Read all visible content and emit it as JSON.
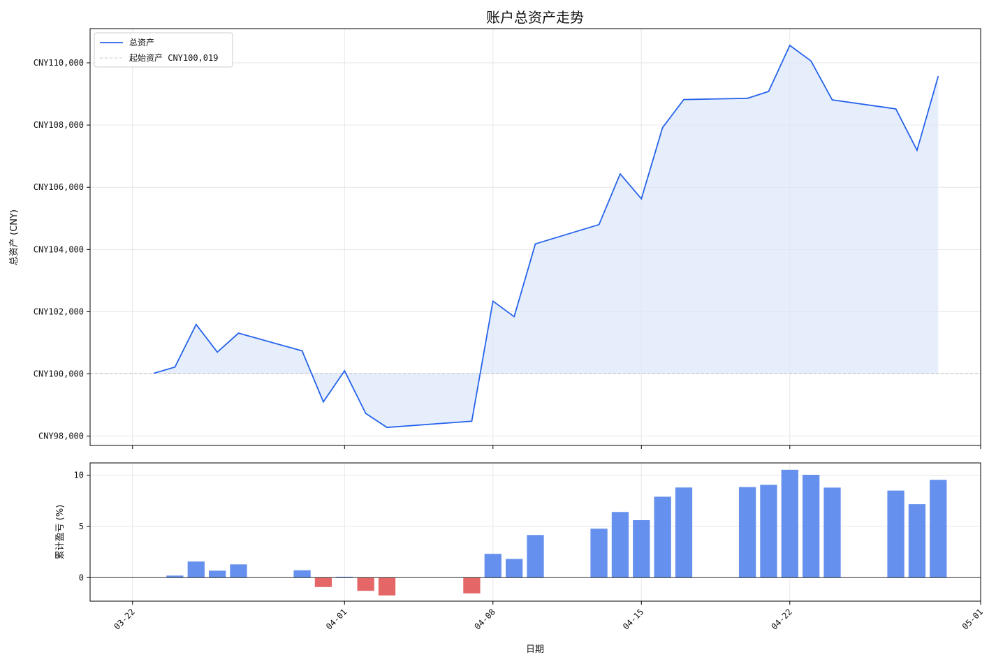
{
  "chart_data": [
    {
      "type": "line",
      "title": "账户总资产走势",
      "xlabel": "",
      "ylabel": "总资产 (CNY)",
      "x_axis_type": "date",
      "xlim": [
        "2024-03-20",
        "2024-05-01"
      ],
      "ylim": [
        97700,
        111100
      ],
      "yticks": [
        98000,
        100000,
        102000,
        104000,
        106000,
        108000,
        110000
      ],
      "ytick_labels": [
        "CNY98,000",
        "CNY100,000",
        "CNY102,000",
        "CNY104,000",
        "CNY106,000",
        "CNY108,000",
        "CNY110,000"
      ],
      "xticks": [
        "2024-03-22",
        "2024-04-01",
        "2024-04-08",
        "2024-04-15",
        "2024-04-22",
        "2024-05-01"
      ],
      "grid": true,
      "legend": "upper-left",
      "series": [
        {
          "name": "总资产",
          "color": "#2563eb",
          "fill": "#dbe6f9",
          "points": [
            [
              "2024-03-23",
              100019
            ],
            [
              "2024-03-24",
              100220
            ],
            [
              "2024-03-25",
              101590
            ],
            [
              "2024-03-26",
              100700
            ],
            [
              "2024-03-27",
              101310
            ],
            [
              "2024-03-30",
              100740
            ],
            [
              "2024-03-31",
              99100
            ],
            [
              "2024-04-01",
              100100
            ],
            [
              "2024-04-02",
              98730
            ],
            [
              "2024-04-03",
              98280
            ],
            [
              "2024-04-07",
              98480
            ],
            [
              "2024-04-08",
              102340
            ],
            [
              "2024-04-09",
              101840
            ],
            [
              "2024-04-10",
              104180
            ],
            [
              "2024-04-13",
              104800
            ],
            [
              "2024-04-14",
              106430
            ],
            [
              "2024-04-15",
              105630
            ],
            [
              "2024-04-16",
              107920
            ],
            [
              "2024-04-17",
              108820
            ],
            [
              "2024-04-20",
              108860
            ],
            [
              "2024-04-21",
              109080
            ],
            [
              "2024-04-22",
              110560
            ],
            [
              "2024-04-23",
              110060
            ],
            [
              "2024-04-24",
              108810
            ],
            [
              "2024-04-27",
              108520
            ],
            [
              "2024-04-28",
              107190
            ],
            [
              "2024-04-29",
              109570
            ]
          ]
        },
        {
          "name": "起始资产 CNY100,019",
          "color": "#c7c7c7",
          "style": "dashed",
          "value": 100019
        }
      ]
    },
    {
      "type": "bar",
      "title": "",
      "xlabel": "日期",
      "ylabel": "累计盈亏 (%)",
      "x_axis_type": "date",
      "xlim": [
        "2024-03-20",
        "2024-05-01"
      ],
      "ylim": [
        -2.3,
        11.2
      ],
      "yticks": [
        0,
        5,
        10
      ],
      "xticks": [
        "2024-03-22",
        "2024-04-01",
        "2024-04-08",
        "2024-04-15",
        "2024-04-22",
        "2024-05-01"
      ],
      "xtick_labels": [
        "03-22",
        "04-01",
        "04-08",
        "04-15",
        "04-22",
        "05-01"
      ],
      "grid": true,
      "positive_color": "#6690ed",
      "negative_color": "#e46666",
      "points": [
        [
          "2024-03-23",
          0.0
        ],
        [
          "2024-03-24",
          0.2
        ],
        [
          "2024-03-25",
          1.57
        ],
        [
          "2024-03-26",
          0.68
        ],
        [
          "2024-03-27",
          1.29
        ],
        [
          "2024-03-30",
          0.72
        ],
        [
          "2024-03-31",
          -0.92
        ],
        [
          "2024-04-01",
          0.08
        ],
        [
          "2024-04-02",
          -1.29
        ],
        [
          "2024-04-03",
          -1.74
        ],
        [
          "2024-04-07",
          -1.54
        ],
        [
          "2024-04-08",
          2.32
        ],
        [
          "2024-04-09",
          1.82
        ],
        [
          "2024-04-10",
          4.16
        ],
        [
          "2024-04-13",
          4.78
        ],
        [
          "2024-04-14",
          6.41
        ],
        [
          "2024-04-15",
          5.61
        ],
        [
          "2024-04-16",
          7.9
        ],
        [
          "2024-04-17",
          8.8
        ],
        [
          "2024-04-20",
          8.84
        ],
        [
          "2024-04-21",
          9.06
        ],
        [
          "2024-04-22",
          10.53
        ],
        [
          "2024-04-23",
          10.04
        ],
        [
          "2024-04-24",
          8.79
        ],
        [
          "2024-04-27",
          8.5
        ],
        [
          "2024-04-28",
          7.17
        ],
        [
          "2024-04-29",
          9.55
        ]
      ]
    }
  ]
}
